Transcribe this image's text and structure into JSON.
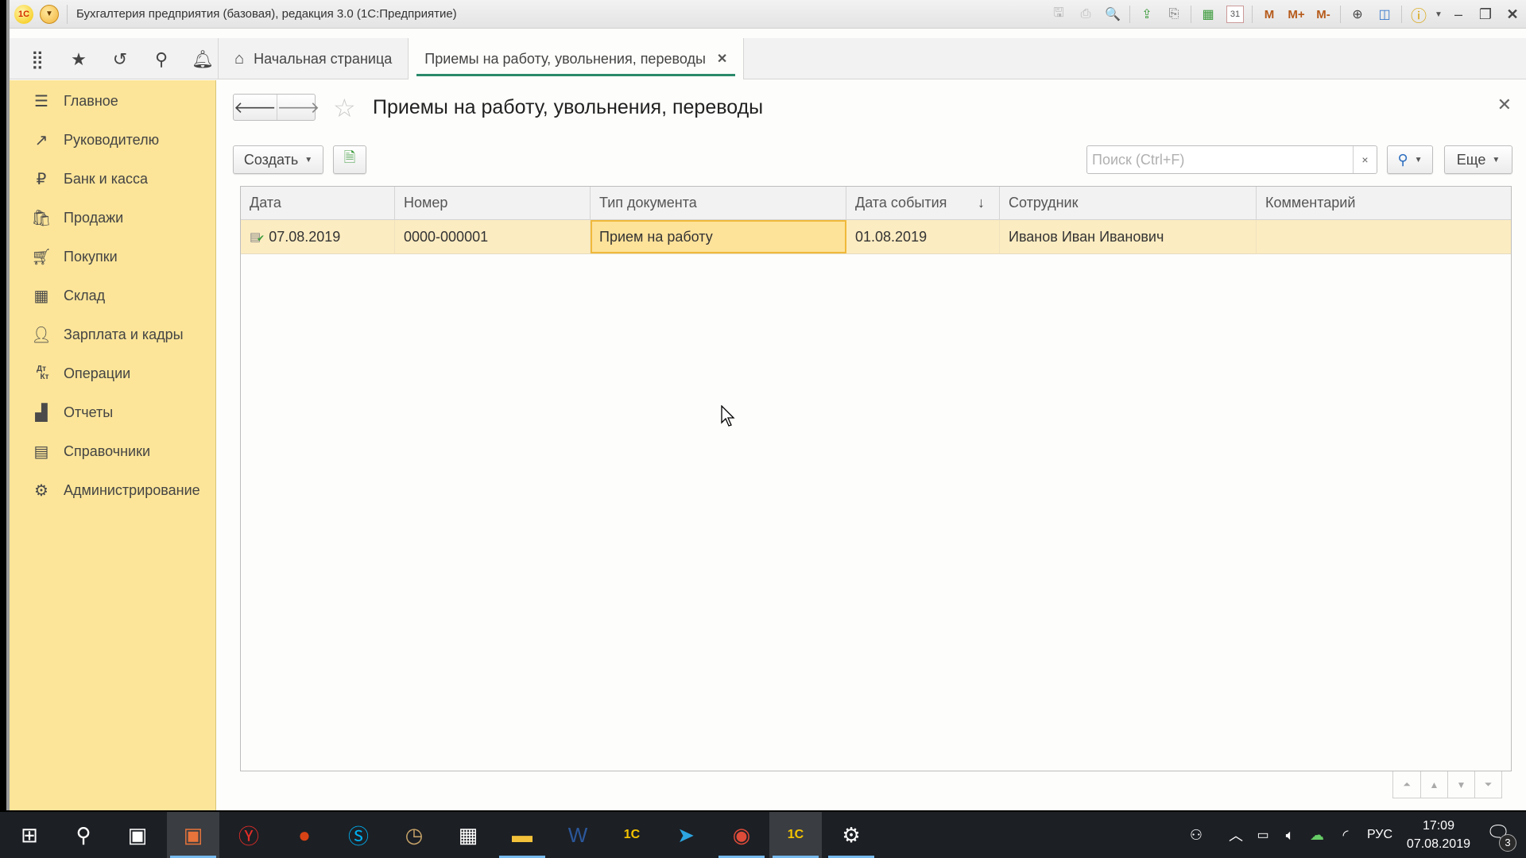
{
  "window": {
    "title": "Бухгалтерия предприятия (базовая), редакция 3.0  (1С:Предприятие)",
    "logo": "1С",
    "toolbar_icons": [
      "save-icon",
      "print-icon",
      "preview-icon",
      "upload-icon",
      "download-icon",
      "calculator-icon",
      "calendar-icon",
      "memory-m",
      "memory-m-plus",
      "memory-m-minus",
      "zoom-icon",
      "panels-icon",
      "info-icon"
    ],
    "memory_labels": {
      "m": "M",
      "mplus": "M+",
      "mminus": "M-"
    },
    "calendar_day": "31"
  },
  "toppanel": {
    "icons": [
      "apps-grid-icon",
      "favorites-star-icon",
      "history-icon",
      "search-icon",
      "notifications-bell-icon"
    ],
    "tabs": [
      {
        "label": "Начальная страница",
        "active": false
      },
      {
        "label": "Приемы на работу, увольнения, переводы",
        "active": true
      }
    ]
  },
  "sidebar": {
    "items": [
      {
        "label": "Главное",
        "icon": "menu-lines-icon"
      },
      {
        "label": "Руководителю",
        "icon": "trend-icon"
      },
      {
        "label": "Банк и касса",
        "icon": "ruble-icon"
      },
      {
        "label": "Продажи",
        "icon": "bag-icon"
      },
      {
        "label": "Покупки",
        "icon": "cart-icon"
      },
      {
        "label": "Склад",
        "icon": "warehouse-icon"
      },
      {
        "label": "Зарплата и кадры",
        "icon": "person-icon"
      },
      {
        "label": "Операции",
        "icon": "dt-kt-icon"
      },
      {
        "label": "Отчеты",
        "icon": "bar-chart-icon"
      },
      {
        "label": "Справочники",
        "icon": "books-icon"
      },
      {
        "label": "Администрирование",
        "icon": "gear-icon"
      }
    ],
    "dtkt": {
      "top": "Дт",
      "bottom": "Кт"
    }
  },
  "form": {
    "title": "Приемы на работу, увольнения, переводы",
    "create_label": "Создать",
    "more_label": "Еще",
    "search_placeholder": "Поиск (Ctrl+F)",
    "search_value": "",
    "clear_label": "×"
  },
  "table": {
    "columns": [
      {
        "label": "Дата"
      },
      {
        "label": "Номер"
      },
      {
        "label": "Тип документа"
      },
      {
        "label": "Дата события",
        "sort": "↓"
      },
      {
        "label": "Сотрудник"
      },
      {
        "label": "Комментарий"
      }
    ],
    "rows": [
      {
        "date": "07.08.2019",
        "number": "0000-000001",
        "doc_type": "Прием на работу",
        "event_date": "01.08.2019",
        "employee": "Иванов Иван Иванович",
        "comment": "",
        "posted": true
      }
    ]
  },
  "taskbar": {
    "apps": [
      "windows-start",
      "search",
      "task-view",
      "presentation-app",
      "yandex-browser",
      "apple-app",
      "skype",
      "clock-app",
      "calculator",
      "file-explorer",
      "word",
      "1c-app",
      "telegram",
      "chrome",
      "1c-app-active",
      "settings"
    ],
    "tray": {
      "lang": "РУС",
      "time": "17:09",
      "date": "07.08.2019",
      "notifications": "3"
    }
  },
  "colors": {
    "sidebar_bg": "#fce599",
    "selected_row": "#fcecc1",
    "focused_cell": "#fde29a",
    "accent_tab": "#2b8a6b"
  }
}
